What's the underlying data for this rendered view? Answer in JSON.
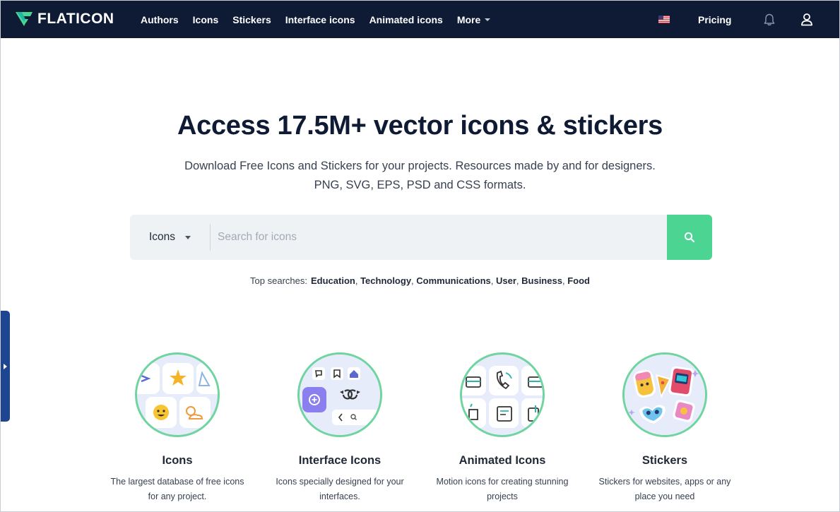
{
  "header": {
    "logo_text": "FLATICON",
    "nav": [
      {
        "label": "Authors"
      },
      {
        "label": "Icons"
      },
      {
        "label": "Stickers"
      },
      {
        "label": "Interface icons"
      },
      {
        "label": "Animated icons"
      },
      {
        "label": "More"
      }
    ],
    "pricing_label": "Pricing"
  },
  "hero": {
    "title": "Access 17.5M+ vector icons & stickers",
    "subtitle_line1": "Download Free Icons and Stickers for your projects. Resources made by and for designers.",
    "subtitle_line2": "PNG, SVG, EPS, PSD and CSS formats."
  },
  "search": {
    "type_label": "Icons",
    "placeholder": "Search for icons",
    "value": ""
  },
  "top_searches": {
    "label": "Top searches:",
    "items": [
      "Education",
      "Technology",
      "Communications",
      "User",
      "Business",
      "Food"
    ]
  },
  "categories": [
    {
      "title": "Icons",
      "desc_line1": "The largest database of free icons",
      "desc_line2": "for any project."
    },
    {
      "title": "Interface Icons",
      "desc_line1": "Icons specially designed for your",
      "desc_line2": "interfaces."
    },
    {
      "title": "Animated Icons",
      "desc_line1": "Motion icons for creating stunning",
      "desc_line2": "projects"
    },
    {
      "title": "Stickers",
      "desc_line1": "Stickers for websites, apps or any",
      "desc_line2": "place you need"
    }
  ],
  "colors": {
    "nav_bg": "#0f1b35",
    "brand_green": "#4cd493",
    "side_tab": "#1e4690"
  }
}
